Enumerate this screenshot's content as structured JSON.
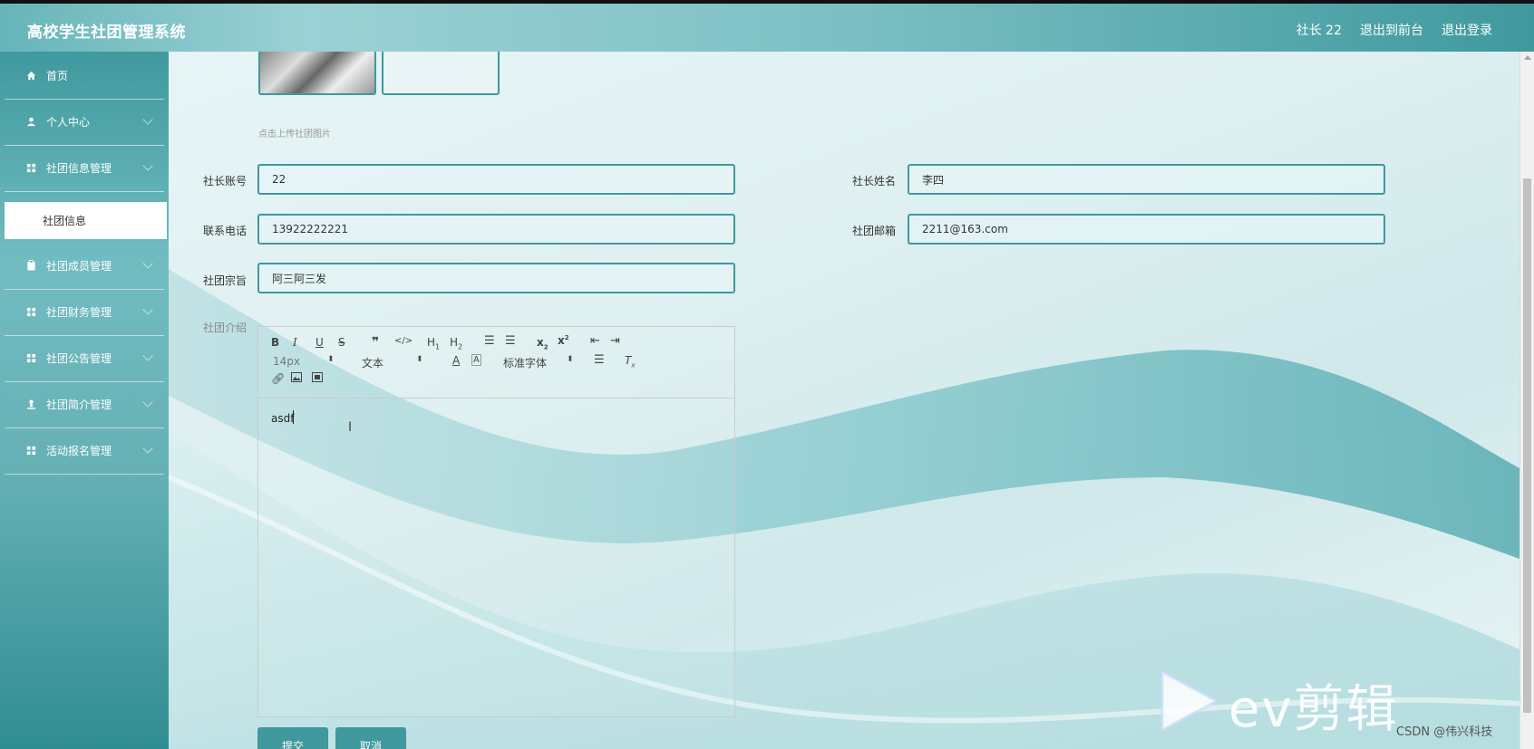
{
  "header": {
    "title": "高校学生社团管理系统",
    "user": "社长 22",
    "to_front": "退出到前台",
    "logout": "退出登录"
  },
  "sidebar": {
    "items": [
      {
        "label": "首页",
        "icon": "home-icon"
      },
      {
        "label": "个人中心",
        "icon": "user-icon"
      },
      {
        "label": "社团信息管理",
        "icon": "grid-icon"
      },
      {
        "label": "社团成员管理",
        "icon": "clipboard-icon"
      },
      {
        "label": "社团财务管理",
        "icon": "grid-icon"
      },
      {
        "label": "社团公告管理",
        "icon": "grid-icon"
      },
      {
        "label": "社团简介管理",
        "icon": "person-icon"
      },
      {
        "label": "活动报名管理",
        "icon": "grid-icon"
      }
    ],
    "active_sub": "社团信息"
  },
  "form": {
    "upload_hint": "点击上传社团图片",
    "leader_account_label": "社长账号",
    "leader_account_value": "22",
    "leader_name_label": "社长姓名",
    "leader_name_value": "李四",
    "phone_label": "联系电话",
    "phone_value": "13922222221",
    "email_label": "社团邮箱",
    "email_value": "2211@163.com",
    "purpose_label": "社团宗旨",
    "purpose_value": "阿三阿三发",
    "intro_label": "社团介绍",
    "submit": "提交",
    "cancel": "取消"
  },
  "editor": {
    "font_size": "14px",
    "text_type": "文本",
    "font_family": "标准字体",
    "content": "asdf"
  },
  "watermark": {
    "brand": "ev剪辑",
    "credit": "CSDN @伟兴科技"
  },
  "colors": {
    "accent": "#3f999e",
    "header_light": "#9bd1d4"
  }
}
